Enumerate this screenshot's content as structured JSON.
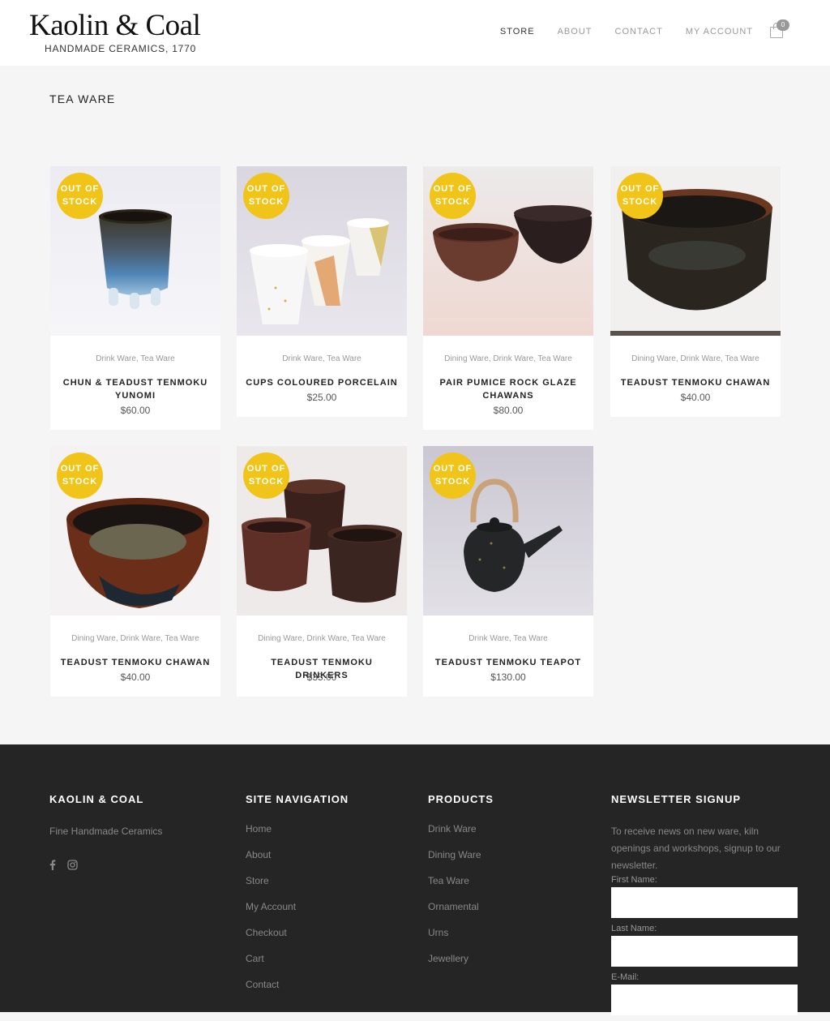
{
  "brand": {
    "name": "Kaolin & Coal",
    "tagline": "HANDMADE CERAMICS, 1770"
  },
  "nav": {
    "items": [
      "STORE",
      "ABOUT",
      "CONTACT",
      "MY ACCOUNT"
    ],
    "active": "STORE",
    "cart_count": "0"
  },
  "page": {
    "title": "TEA WARE"
  },
  "badge_text": [
    "OUT OF",
    "STOCK"
  ],
  "products": [
    {
      "categories": "Drink Ware, Tea Ware",
      "name": "CHUN & TEADUST TENMOKU YUNOMI",
      "price": "$60.00"
    },
    {
      "categories": "Drink Ware, Tea Ware",
      "name": "CUPS COLOURED PORCELAIN",
      "price": "$25.00"
    },
    {
      "categories": "Dining Ware, Drink Ware, Tea Ware",
      "name": "PAIR PUMICE ROCK GLAZE CHAWANS",
      "price": "$80.00"
    },
    {
      "categories": "Dining Ware, Drink Ware, Tea Ware",
      "name": "TEADUST TENMOKU CHAWAN",
      "price": "$40.00"
    },
    {
      "categories": "Dining Ware, Drink Ware, Tea Ware",
      "name": "TEADUST TENMOKU CHAWAN",
      "price": "$40.00"
    },
    {
      "categories": "Dining Ware, Drink Ware, Tea Ware",
      "name": "TEADUST TENMOKU DRINKERS",
      "price": "$35.00"
    },
    {
      "categories": "Drink Ware, Tea Ware",
      "name": "TEADUST TENMOKU TEAPOT",
      "price": "$130.00"
    }
  ],
  "footer": {
    "about": {
      "heading": "KAOLIN & COAL",
      "text": "Fine Handmade Ceramics",
      "social_icons": [
        "facebook-icon",
        "instagram-icon"
      ]
    },
    "site_nav": {
      "heading": "SITE NAVIGATION",
      "links": [
        "Home",
        "About",
        "Store",
        "My Account",
        "Checkout",
        "Cart",
        "Contact"
      ]
    },
    "products": {
      "heading": "PRODUCTS",
      "links": [
        "Drink Ware",
        "Dining Ware",
        "Tea Ware",
        "Ornamental",
        "Urns",
        "Jewellery"
      ]
    },
    "newsletter": {
      "heading": "NEWSLETTER SIGNUP",
      "text": "To receive news on new ware, kiln openings and workshops, signup to our newsletter.",
      "first_name_label": "First Name:",
      "last_name_label": "Last Name:",
      "email_label": "E-Mail:"
    }
  },
  "colors": {
    "badge": "#f0c419",
    "footer_bg": "#252525",
    "page_bg": "#f5f5f5"
  }
}
